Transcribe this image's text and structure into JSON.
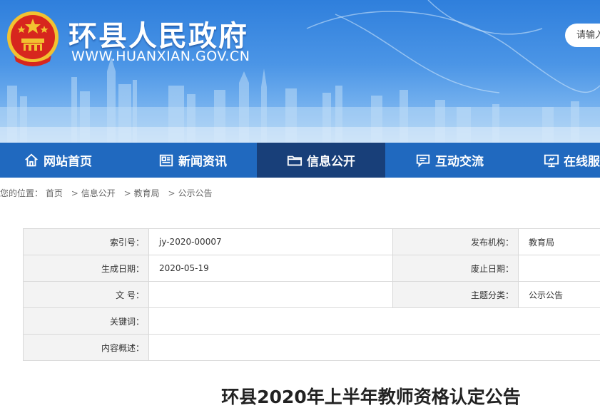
{
  "header": {
    "site_title": "环县人民政府",
    "site_url": "WWW.HUANXIAN.GOV.CN",
    "search_placeholder": "请输入"
  },
  "nav": [
    {
      "label": "网站首页",
      "icon": "home-icon",
      "active": false
    },
    {
      "label": "新闻资讯",
      "icon": "news-icon",
      "active": false
    },
    {
      "label": "信息公开",
      "icon": "folder-icon",
      "active": true
    },
    {
      "label": "互动交流",
      "icon": "chat-icon",
      "active": false
    },
    {
      "label": "在线服务",
      "icon": "monitor-icon",
      "active": false
    }
  ],
  "breadcrumb": {
    "prefix": "您的位置：",
    "items": [
      "首页",
      "信息公开",
      "教育局",
      "公示公告"
    ],
    "separator": ">"
  },
  "info": {
    "index_label": "索引号：",
    "index_value": "jy-2020-00007",
    "publisher_label": "发布机构：",
    "publisher_value": "教育局",
    "created_label": "生成日期：",
    "created_value": "2020-05-19",
    "expire_label": "废止日期：",
    "expire_value": "",
    "docno_label": "文 号：",
    "docno_value": "",
    "topic_label": "主题分类：",
    "topic_value": "公示公告",
    "keywords_label": "关键词：",
    "keywords_value": "",
    "summary_label": "内容概述：",
    "summary_value": ""
  },
  "article": {
    "title": "环县2020年上半年教师资格认定公告"
  },
  "colors": {
    "nav_bg": "#2069bf",
    "nav_active": "#183f79",
    "banner_top": "#2f7fdc",
    "banner_bottom": "#a9cff5",
    "emblem_red": "#d7261e",
    "emblem_gold": "#f2c230"
  }
}
